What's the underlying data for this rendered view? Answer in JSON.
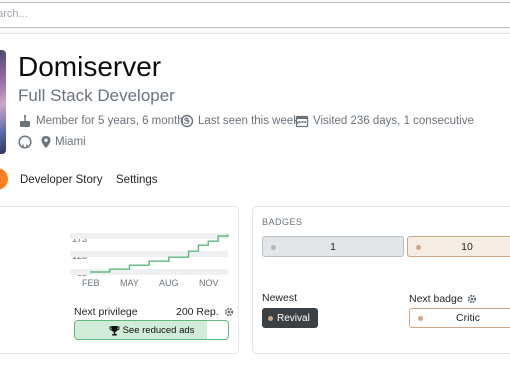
{
  "search": {
    "placeholder": "earch..."
  },
  "profile": {
    "name": "Domiserver",
    "title": "Full Stack Developer",
    "member_for": "Member for 5 years, 6 months",
    "last_seen": "Last seen this week",
    "visited": "Visited 236 days, 1 consecutive",
    "location": "Miami"
  },
  "nav": {
    "developer_story": "Developer Story",
    "settings": "Settings"
  },
  "chart_data": {
    "type": "line",
    "x": [
      "FEB",
      "MAY",
      "AUG",
      "NOV"
    ],
    "y_ticks": [
      83,
      128,
      173
    ],
    "series": [
      {
        "values": [
          83,
          83,
          90,
          90,
          100,
          100,
          110,
          110,
          120,
          120,
          135,
          150,
          160,
          173,
          177
        ]
      }
    ],
    "color": "#5eba7d"
  },
  "privilege": {
    "label": "Next privilege",
    "rep": "200 Rep.",
    "text": "See reduced ads",
    "progress": 0.86
  },
  "badges": {
    "title": "BADGES",
    "silver_count": "1",
    "bronze_count": "10",
    "newest_label": "Newest",
    "newest_badge": "Revival",
    "next_label": "Next badge",
    "next_badge": "Critic",
    "silver_color": "#b4b8bc",
    "bronze_color": "#d1a684"
  }
}
